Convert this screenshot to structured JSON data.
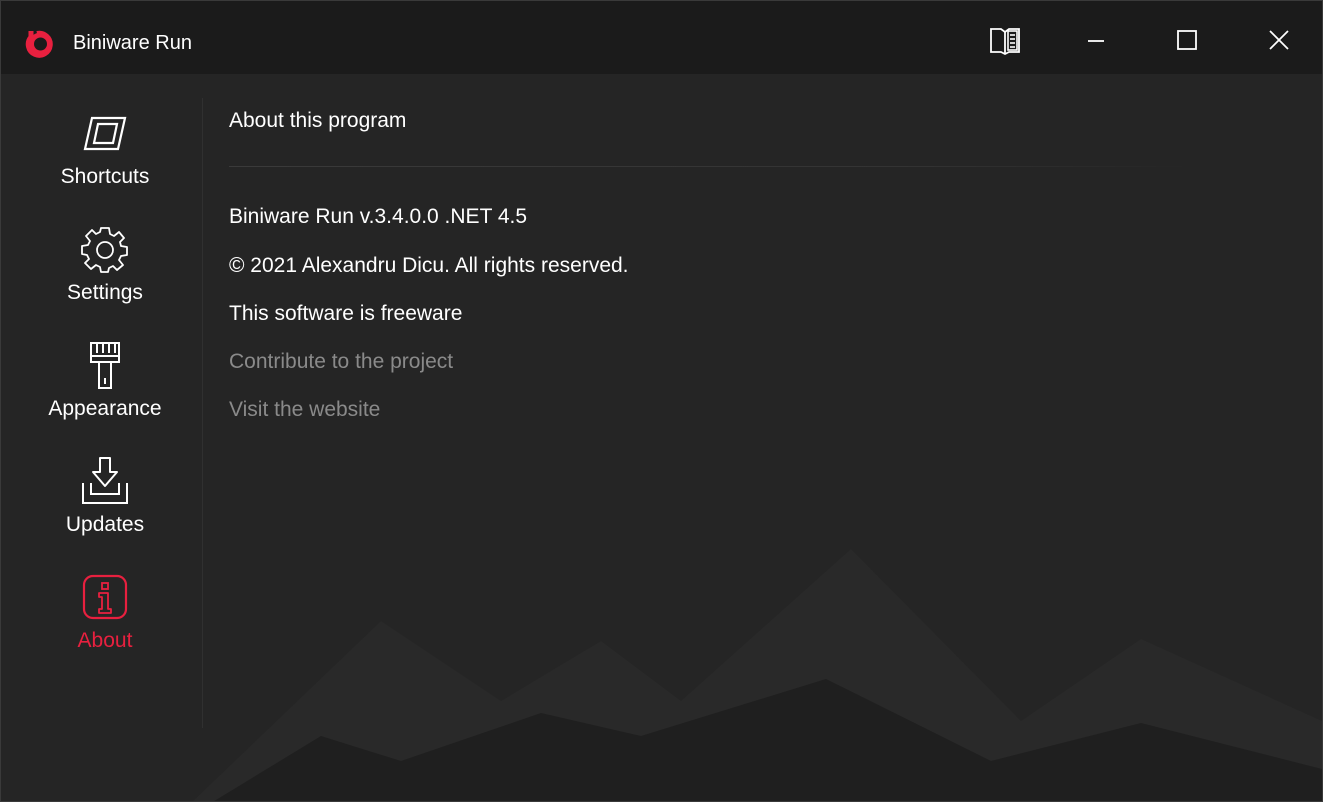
{
  "window": {
    "title": "Biniware Run"
  },
  "titlebar": {
    "book_icon": "book-icon",
    "minimize_icon": "minimize-icon",
    "maximize_icon": "maximize-icon",
    "close_icon": "close-icon"
  },
  "sidebar": {
    "items": [
      {
        "label": "Shortcuts",
        "icon": "shortcuts-icon",
        "active": false
      },
      {
        "label": "Settings",
        "icon": "gear-icon",
        "active": false
      },
      {
        "label": "Appearance",
        "icon": "brush-icon",
        "active": false
      },
      {
        "label": "Updates",
        "icon": "download-icon",
        "active": false
      },
      {
        "label": "About",
        "icon": "info-icon",
        "active": true
      }
    ]
  },
  "about": {
    "title": "About this program",
    "version": "Biniware Run v.3.4.0.0 .NET 4.5",
    "copyright": "© 2021 Alexandru Dicu. All rights reserved.",
    "license": "This software is freeware",
    "contribute_link": "Contribute to the project",
    "website_link": "Visit the website"
  },
  "colors": {
    "accent": "#e8203f",
    "titlebar_bg": "#1b1b1b",
    "content_bg": "#252525",
    "link_text": "#8a8a8a"
  }
}
